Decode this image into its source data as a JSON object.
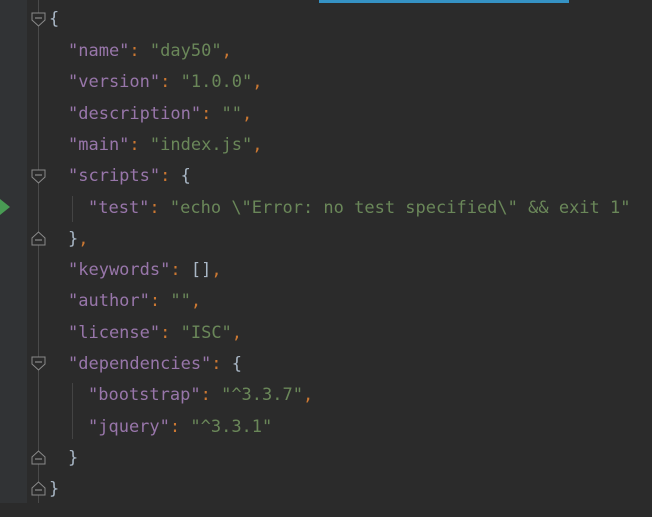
{
  "colors": {
    "background": "#2b2b2b",
    "gutter": "#313335",
    "key": "#9876aa",
    "string": "#6a8759",
    "punctuation": "#cc7832",
    "brace": "#a9b7c6",
    "accent": "#3592c4",
    "run_marker": "#499c54"
  },
  "icons": {
    "fold": "fold-marker-icon",
    "run": "run-arrow-icon"
  },
  "tokens": {
    "open_brace": "{",
    "close_brace": "}",
    "colon": ": ",
    "comma": ",",
    "empty_array": "[]"
  },
  "code": {
    "name_key": "\"name\"",
    "name_val": "\"day50\"",
    "version_key": "\"version\"",
    "version_val": "\"1.0.0\"",
    "description_key": "\"description\"",
    "description_val": "\"\"",
    "main_key": "\"main\"",
    "main_val": "\"index.js\"",
    "scripts_key": "\"scripts\"",
    "test_key": "\"test\"",
    "test_val": "\"echo \\\"Error: no test specified\\\" && exit 1\"",
    "keywords_key": "\"keywords\"",
    "author_key": "\"author\"",
    "author_val": "\"\"",
    "license_key": "\"license\"",
    "license_val": "\"ISC\"",
    "dependencies_key": "\"dependencies\"",
    "bootstrap_key": "\"bootstrap\"",
    "bootstrap_val": "\"^3.3.7\"",
    "jquery_key": "\"jquery\"",
    "jquery_val": "\"^3.3.1\""
  }
}
